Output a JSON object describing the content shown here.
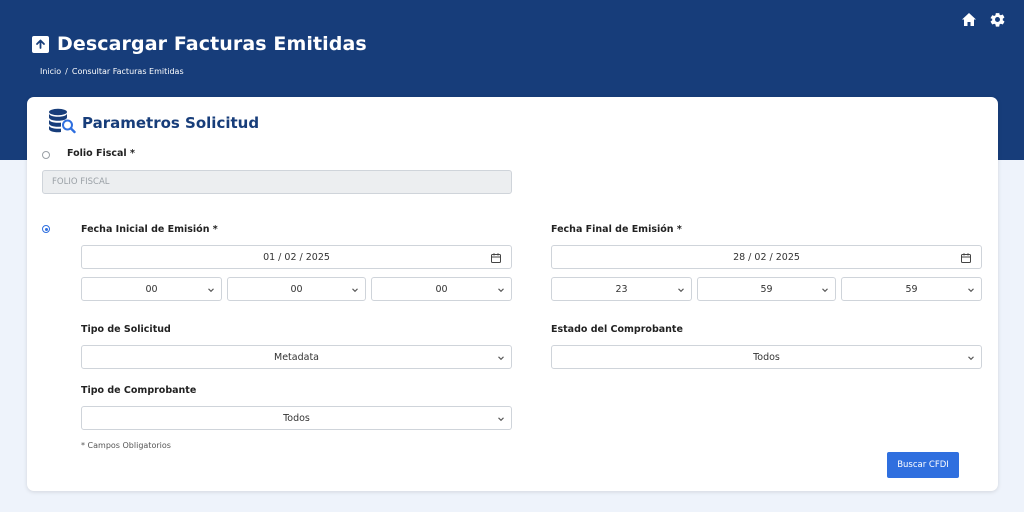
{
  "header": {
    "title": "Descargar Facturas Emitidas",
    "breadcrumb": [
      "Inicio",
      "/",
      "Consultar Facturas Emitidas"
    ]
  },
  "card": {
    "title": "Parametros Solicitud",
    "folio": {
      "label": "Folio Fiscal *",
      "placeholder": "FOLIO FISCAL",
      "selected": false
    },
    "fechas": {
      "selected": true,
      "inicial": {
        "label": "Fecha Inicial de Emisión *",
        "date": "01 / 02 / 2025",
        "hour": "00",
        "minute": "00",
        "second": "00"
      },
      "final": {
        "label": "Fecha Final de Emisión *",
        "date": "28 / 02 / 2025",
        "hour": "23",
        "minute": "59",
        "second": "59"
      }
    },
    "tipo_solicitud": {
      "label": "Tipo de Solicitud",
      "value": "Metadata"
    },
    "estado": {
      "label": "Estado del Comprobante",
      "value": "Todos"
    },
    "tipo_comprobante": {
      "label": "Tipo de Comprobante",
      "value": "Todos"
    },
    "note": "* Campos Obligatorios",
    "button": "Buscar CFDI"
  },
  "icons": {
    "home": "home-icon",
    "settings": "gear-icon",
    "upload": "upload-icon",
    "database_search": "database-search-icon"
  },
  "colors": {
    "header": "#173d7a",
    "accent": "#2f6fdf",
    "background": "#eef3fb"
  }
}
